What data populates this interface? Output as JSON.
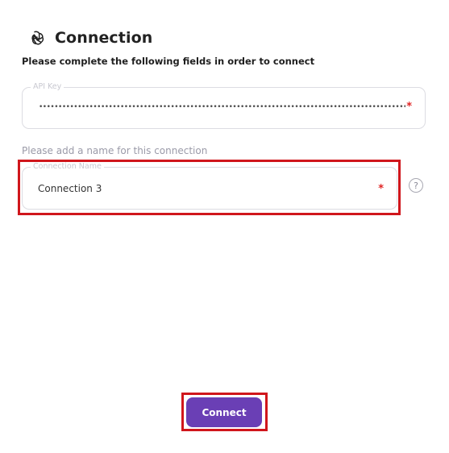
{
  "header": {
    "logo_icon": "openai-logo-icon",
    "title": "Connection"
  },
  "subtitle": "Please complete the following fields in order to connect",
  "api_key": {
    "legend": "API Key",
    "masked_value": "••••••••••••••••••••••••••••••••••••••••••••••••••••••••••••••••••••••••••••••••••••••••••••••••••••••••••••••••••••••",
    "required_marker": "*"
  },
  "connection_name": {
    "hint": "Please add a name for this connection",
    "legend": "Connection Name",
    "value": "Connection 3",
    "required_marker": "*",
    "help_label": "?"
  },
  "connect_button": {
    "label": "Connect",
    "color": "#6a3fb5"
  },
  "highlight_color": "#d0161c"
}
